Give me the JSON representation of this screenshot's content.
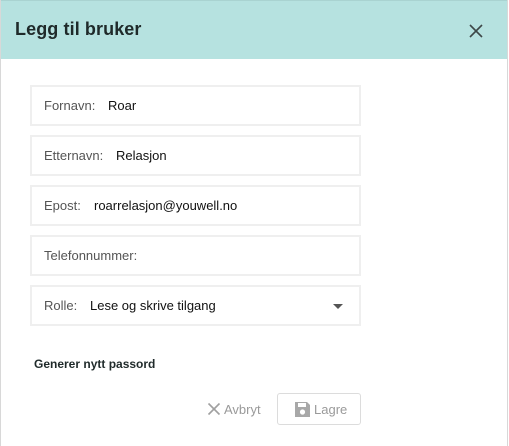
{
  "dialog": {
    "title": "Legg til bruker",
    "close_icon": "close-icon"
  },
  "form": {
    "first_name": {
      "label": "Fornavn:",
      "value": "Roar"
    },
    "last_name": {
      "label": "Etternavn:",
      "value": "Relasjon"
    },
    "email": {
      "label": "Epost:",
      "value": "roarrelasjon@youwell.no"
    },
    "phone": {
      "label": "Telefonnummer:",
      "value": ""
    },
    "role": {
      "label": "Rolle:",
      "value": "Lese og skrive tilgang"
    }
  },
  "actions": {
    "generate_password": "Generer nytt passord",
    "cancel_label": "Avbryt",
    "save_label": "Lagre",
    "cancel_icon": "close-icon",
    "save_icon": "floppy-disk-icon"
  },
  "colors": {
    "header_bg": "#b6e2e0",
    "disabled_text": "#9a9a9a"
  }
}
